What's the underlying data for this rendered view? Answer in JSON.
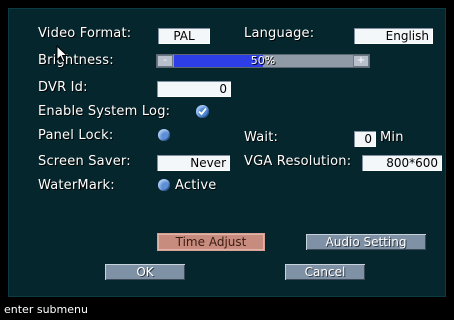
{
  "settings": {
    "video_format": {
      "label": "Video Format:",
      "value": "PAL"
    },
    "language": {
      "label": "Language:",
      "value": "English"
    },
    "brightness": {
      "label": "Brightness:",
      "value_text": "50%",
      "value": 50,
      "minus": "-",
      "plus": "+"
    },
    "dvr_id": {
      "label": "DVR Id:",
      "value": "0"
    },
    "enable_system_log": {
      "label": "Enable System Log:",
      "checked": true
    },
    "panel_lock": {
      "label": "Panel Lock:"
    },
    "wait": {
      "label": "Wait:",
      "value": "0",
      "unit": "Min"
    },
    "screen_saver": {
      "label": "Screen Saver:",
      "value": "Never"
    },
    "vga_resolution": {
      "label": "VGA Resolution:",
      "value": "800*600"
    },
    "watermark": {
      "label": "WaterMark:",
      "option_label": "Active"
    }
  },
  "buttons": {
    "time_adjust": "Time Adjust",
    "audio_setting": "Audio Setting",
    "ok": "OK",
    "cancel": "Cancel"
  },
  "status": "enter submenu",
  "colors": {
    "panel_bg": "#05262c",
    "field_bg": "#f4f7fa",
    "slider_fill": "#2d3ee6",
    "button_bg": "#7f91a4",
    "button_active_bg": "#c88c7e"
  },
  "icons": {
    "check": "checkmark-icon",
    "radio": "radio-dot-icon",
    "cursor": "mouse-pointer-icon"
  }
}
